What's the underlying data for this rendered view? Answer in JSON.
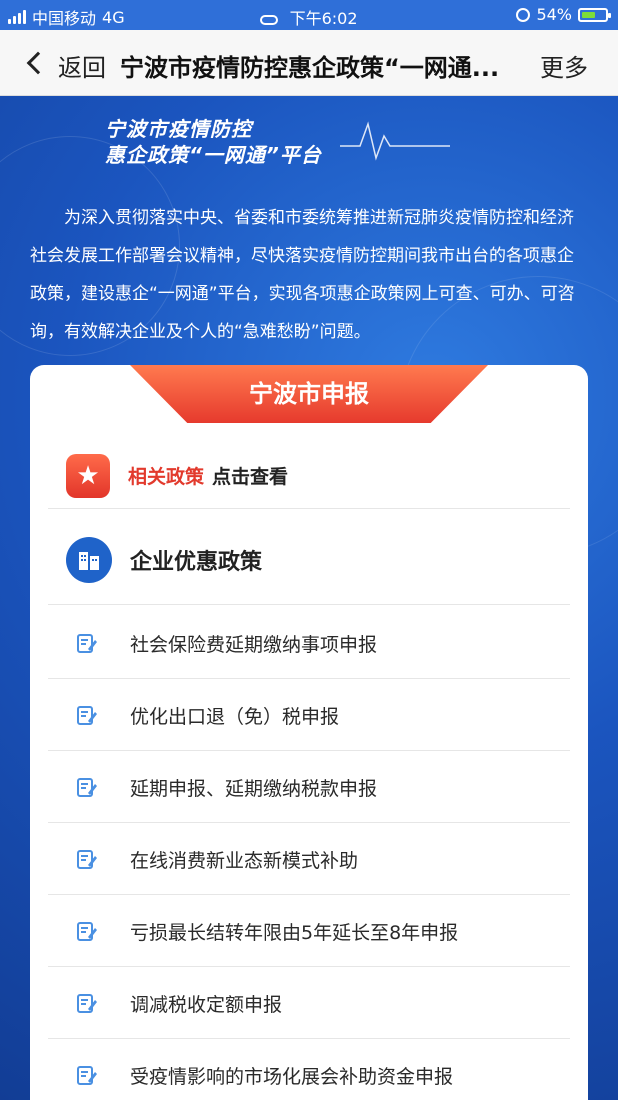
{
  "status_bar": {
    "carrier": "中国移动",
    "network": "4G",
    "time": "下午6:02",
    "battery": "54%",
    "battery_level": 0.54
  },
  "nav": {
    "back_label": "返回",
    "title": "宁波市疫情防控惠企政策“一网通...",
    "more_label": "更多"
  },
  "banner": {
    "title_line1": "宁波市疫情防控",
    "title_line2": "惠企政策“一网通”平台",
    "intro": "为深入贯彻落实中央、省委和市委统筹推进新冠肺炎疫情防控和经济社会发展工作部署会议精神，尽快落实疫情防控期间我市出台的各项惠企政策，建设惠企“一网通”平台，实现各项惠企政策网上可查、可办、可咨询，有效解决企业及个人的“急难愁盼”问题。"
  },
  "card": {
    "header": "宁波市申报",
    "policy_link": {
      "red_text": "相关政策",
      "black_text": "点击查看"
    },
    "section_title": "企业优惠政策",
    "items": [
      "社会保险费延期缴纳事项申报",
      "优化出口退（免）税申报",
      "延期申报、延期缴纳税款申报",
      "在线消费新业态新模式补助",
      "亏损最长结转年限由5年延长至8年申报",
      "调减税收定额申报",
      "受疫情影响的市场化展会补助资金申报"
    ]
  },
  "colors": {
    "accent_red": "#e23a2d",
    "banner_blue": "#1b55bf",
    "icon_blue": "#1f63c9"
  }
}
